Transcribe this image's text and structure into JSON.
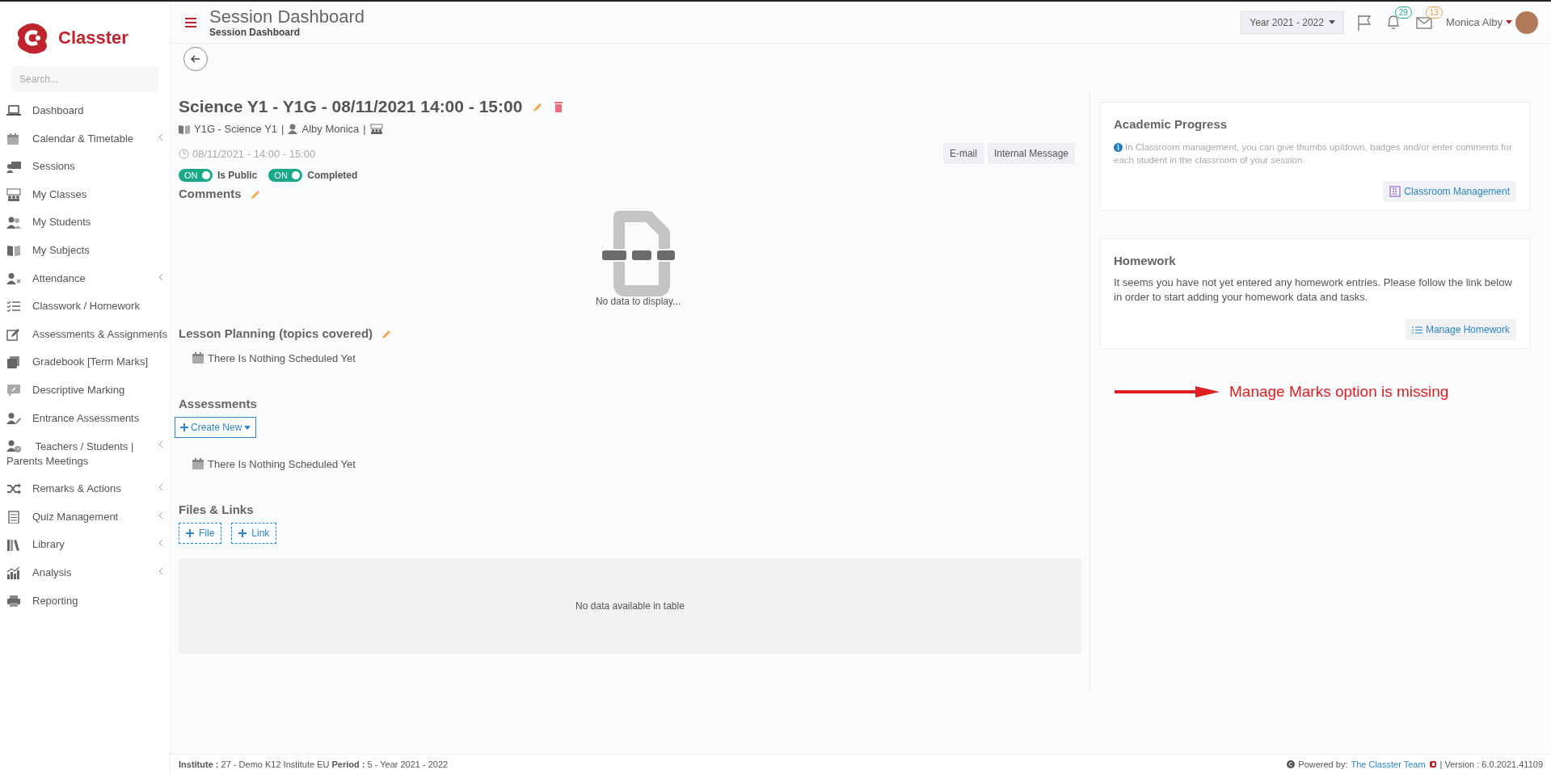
{
  "sidebar": {
    "logo_text": "Classter",
    "search": {
      "placeholder": "Search..."
    },
    "items": [
      {
        "label": "Dashboard",
        "has_submenu": false
      },
      {
        "label": "Calendar & Timetable",
        "has_submenu": true
      },
      {
        "label": "Sessions",
        "has_submenu": false
      },
      {
        "label": "My Classes",
        "has_submenu": false
      },
      {
        "label": "My Students",
        "has_submenu": false
      },
      {
        "label": "My Subjects",
        "has_submenu": false
      },
      {
        "label": "Attendance",
        "has_submenu": true
      },
      {
        "label": "Classwork / Homework",
        "has_submenu": false
      },
      {
        "label": "Assessments & Assignments",
        "has_submenu": true
      },
      {
        "label": "Gradebook [Term Marks]",
        "has_submenu": false
      },
      {
        "label": "Descriptive Marking",
        "has_submenu": false
      },
      {
        "label": "Entrance Assessments",
        "has_submenu": false
      },
      {
        "label": "Teachers / Students | Parents Meetings",
        "has_submenu": true
      },
      {
        "label": "Remarks & Actions",
        "has_submenu": true
      },
      {
        "label": "Quiz Management",
        "has_submenu": true
      },
      {
        "label": "Library",
        "has_submenu": true
      },
      {
        "label": "Analysis",
        "has_submenu": true
      },
      {
        "label": "Reporting",
        "has_submenu": false
      }
    ]
  },
  "header": {
    "title": "Session Dashboard",
    "breadcrumb": "Session Dashboard",
    "year_selector": "Year 2021 - 2022",
    "notifications_count": "29",
    "messages_count": "13",
    "user_name": "Monica Alby"
  },
  "session": {
    "title": "Science Y1 - Y1G - 08/11/2021 14:00 - 15:00",
    "class_label": "Y1G - Science Y1",
    "separator_1": "|",
    "teacher": "Alby Monica",
    "separator_2": "|",
    "datetime": "08/11/2021 - 14:00 - 15:00",
    "buttons": [
      "E-mail",
      "Internal Message"
    ],
    "toggles": [
      {
        "state_text": "ON",
        "label": "Is Public",
        "on": true
      },
      {
        "state_text": "ON",
        "label": "Completed",
        "on": true
      }
    ]
  },
  "comments": {
    "heading": "Comments",
    "empty_text": "No data to display..."
  },
  "lesson_planning": {
    "heading": "Lesson Planning (topics covered)",
    "empty_text": "There Is Nothing Scheduled Yet"
  },
  "assessments": {
    "heading": "Assessments",
    "create_button": "Create New",
    "empty_text": "There Is Nothing Scheduled Yet"
  },
  "files_links": {
    "heading": "Files & Links",
    "buttons": [
      "File",
      "Link"
    ],
    "table_empty": "No data available in table"
  },
  "academic_progress": {
    "heading": "Academic Progress",
    "info": "In Classroom management, you can give thumbs up/down, badges and/or enter comments for each student in the classroom of your session.",
    "button": "Classroom Management"
  },
  "homework": {
    "heading": "Homework",
    "text": "It seems you have not yet entered any homework entries. Please follow the link below in order to start adding your homework data and tasks.",
    "button": "Manage Homework"
  },
  "annotation": {
    "text": "Manage Marks option is missing"
  },
  "footer": {
    "left": "**Institute :** 27 - Demo K12 Institute EU **Period :** 5 - Year 2021 - 2022",
    "powered_by": "Powered by:",
    "team_link": "The Classter Team",
    "version": "| Version : 6.0.2021.41109"
  }
}
